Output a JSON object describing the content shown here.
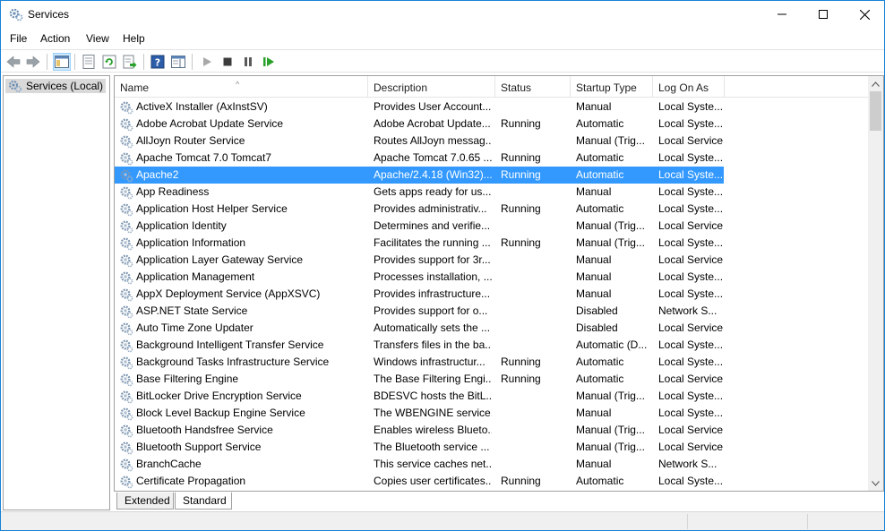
{
  "window": {
    "title": "Services"
  },
  "menu": [
    "File",
    "Action",
    "View",
    "Help"
  ],
  "tree": {
    "root_label": "Services (Local)"
  },
  "columns": [
    "Name",
    "Description",
    "Status",
    "Startup Type",
    "Log On As"
  ],
  "services": [
    [
      "ActiveX Installer (AxInstSV)",
      "Provides User Account...",
      "",
      "Manual",
      "Local Syste..."
    ],
    [
      "Adobe Acrobat Update Service",
      "Adobe Acrobat Update...",
      "Running",
      "Automatic",
      "Local Syste..."
    ],
    [
      "AllJoyn Router Service",
      "Routes AllJoyn messag...",
      "",
      "Manual (Trig...",
      "Local Service"
    ],
    [
      "Apache Tomcat 7.0 Tomcat7",
      "Apache Tomcat 7.0.65 ...",
      "Running",
      "Automatic",
      "Local Syste..."
    ],
    [
      "Apache2",
      "Apache/2.4.18 (Win32)...",
      "Running",
      "Automatic",
      "Local Syste..."
    ],
    [
      "App Readiness",
      "Gets apps ready for us...",
      "",
      "Manual",
      "Local Syste..."
    ],
    [
      "Application Host Helper Service",
      "Provides administrativ...",
      "Running",
      "Automatic",
      "Local Syste..."
    ],
    [
      "Application Identity",
      "Determines and verifie...",
      "",
      "Manual (Trig...",
      "Local Service"
    ],
    [
      "Application Information",
      "Facilitates the running ...",
      "Running",
      "Manual (Trig...",
      "Local Syste..."
    ],
    [
      "Application Layer Gateway Service",
      "Provides support for 3r...",
      "",
      "Manual",
      "Local Service"
    ],
    [
      "Application Management",
      "Processes installation, ...",
      "",
      "Manual",
      "Local Syste..."
    ],
    [
      "AppX Deployment Service (AppXSVC)",
      "Provides infrastructure...",
      "",
      "Manual",
      "Local Syste..."
    ],
    [
      "ASP.NET State Service",
      "Provides support for o...",
      "",
      "Disabled",
      "Network S..."
    ],
    [
      "Auto Time Zone Updater",
      "Automatically sets the ...",
      "",
      "Disabled",
      "Local Service"
    ],
    [
      "Background Intelligent Transfer Service",
      "Transfers files in the ba...",
      "",
      "Automatic (D...",
      "Local Syste..."
    ],
    [
      "Background Tasks Infrastructure Service",
      "Windows infrastructur...",
      "Running",
      "Automatic",
      "Local Syste..."
    ],
    [
      "Base Filtering Engine",
      "The Base Filtering Engi...",
      "Running",
      "Automatic",
      "Local Service"
    ],
    [
      "BitLocker Drive Encryption Service",
      "BDESVC hosts the BitL...",
      "",
      "Manual (Trig...",
      "Local Syste..."
    ],
    [
      "Block Level Backup Engine Service",
      "The WBENGINE service...",
      "",
      "Manual",
      "Local Syste..."
    ],
    [
      "Bluetooth Handsfree Service",
      "Enables wireless Blueto...",
      "",
      "Manual (Trig...",
      "Local Service"
    ],
    [
      "Bluetooth Support Service",
      "The Bluetooth service ...",
      "",
      "Manual (Trig...",
      "Local Service"
    ],
    [
      "BranchCache",
      "This service caches net...",
      "",
      "Manual",
      "Network S..."
    ],
    [
      "Certificate Propagation",
      "Copies user certificates...",
      "Running",
      "Automatic",
      "Local Syste..."
    ]
  ],
  "selected_service": "Apache2",
  "tabs": [
    "Extended",
    "Standard"
  ],
  "active_tab": "Standard",
  "colors": {
    "selection": "#3399ff",
    "window_border": "#1883d7"
  }
}
